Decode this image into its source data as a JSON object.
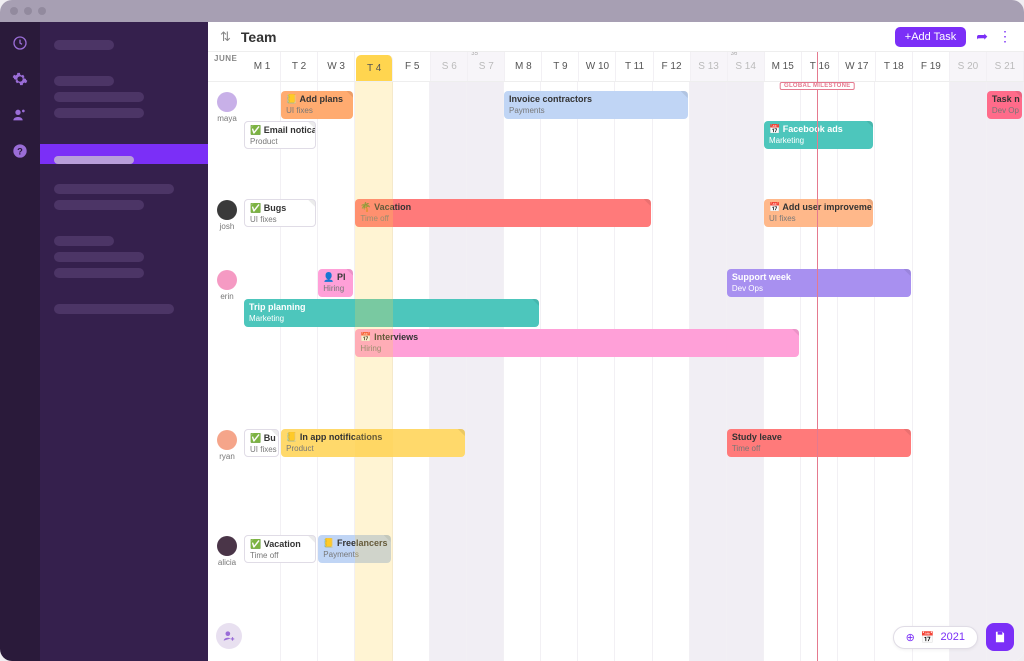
{
  "header": {
    "title": "Team",
    "add_task_label": "+Add Task"
  },
  "month_label": "JUNE",
  "days": [
    {
      "l": "M 1",
      "w": false,
      "today": false,
      "wk": ""
    },
    {
      "l": "T 2",
      "w": false,
      "today": false,
      "wk": ""
    },
    {
      "l": "W 3",
      "w": false,
      "today": false,
      "wk": ""
    },
    {
      "l": "T 4",
      "w": false,
      "today": true,
      "wk": ""
    },
    {
      "l": "F 5",
      "w": false,
      "today": false,
      "wk": ""
    },
    {
      "l": "S 6",
      "w": true,
      "today": false,
      "wk": ""
    },
    {
      "l": "S 7",
      "w": true,
      "today": false,
      "wk": "35"
    },
    {
      "l": "M 8",
      "w": false,
      "today": false,
      "wk": ""
    },
    {
      "l": "T 9",
      "w": false,
      "today": false,
      "wk": ""
    },
    {
      "l": "W 10",
      "w": false,
      "today": false,
      "wk": ""
    },
    {
      "l": "T 11",
      "w": false,
      "today": false,
      "wk": ""
    },
    {
      "l": "F 12",
      "w": false,
      "today": false,
      "wk": ""
    },
    {
      "l": "S 13",
      "w": true,
      "today": false,
      "wk": ""
    },
    {
      "l": "S 14",
      "w": true,
      "today": false,
      "wk": "36"
    },
    {
      "l": "M 15",
      "w": false,
      "today": false,
      "wk": ""
    },
    {
      "l": "T 16",
      "w": false,
      "today": false,
      "wk": ""
    },
    {
      "l": "W 17",
      "w": false,
      "today": false,
      "wk": ""
    },
    {
      "l": "T 18",
      "w": false,
      "today": false,
      "wk": ""
    },
    {
      "l": "F 19",
      "w": false,
      "today": false,
      "wk": ""
    },
    {
      "l": "S 20",
      "w": true,
      "today": false,
      "wk": ""
    },
    {
      "l": "S 21",
      "w": true,
      "today": false,
      "wk": ""
    }
  ],
  "milestone": {
    "label": "GLOBAL MILESTONE",
    "pos_pct": 73.5
  },
  "people": [
    {
      "name": "maya",
      "avatar_color": "#c8b0e8",
      "lanes": [
        [
          {
            "label": "📒 Add plans",
            "tag": "UI fixes",
            "cls": "orange",
            "start": 1,
            "span": 2
          },
          {
            "label": "Invoice contractors",
            "tag": "Payments",
            "cls": "blue",
            "start": 7,
            "span": 5
          },
          {
            "label": "Task n",
            "tag": "Dev Op",
            "cls": "pink",
            "start": 20,
            "span": 1
          }
        ],
        [
          {
            "label": "✅ Email notica",
            "tag": "Product",
            "cls": "white",
            "start": 0,
            "span": 2
          },
          {
            "label": "📅 Facebook ads",
            "tag": "Marketing",
            "cls": "teal",
            "start": 14,
            "span": 3
          }
        ]
      ]
    },
    {
      "name": "josh",
      "avatar_color": "#3a3a3a",
      "lanes": [
        [
          {
            "label": "✅ Bugs",
            "tag": "UI fixes",
            "cls": "white",
            "start": 0,
            "span": 2
          },
          {
            "label": "🌴 Vacation",
            "tag": "Time off",
            "cls": "red",
            "start": 3,
            "span": 8
          },
          {
            "label": "📅 Add user improveme",
            "tag": "UI fixes",
            "cls": "orangel",
            "start": 14,
            "span": 3
          }
        ]
      ]
    },
    {
      "name": "erin",
      "avatar_color": "#f59ac3",
      "lanes": [
        [
          {
            "label": "👤 Pl",
            "tag": "Hiring",
            "cls": "pinkl",
            "start": 2,
            "span": 1
          },
          {
            "label": "Support week",
            "tag": "Dev Ops",
            "cls": "purple",
            "start": 13,
            "span": 5
          }
        ],
        [
          {
            "label": "Trip planning",
            "tag": "Marketing",
            "cls": "teal",
            "start": 0,
            "span": 8
          }
        ],
        [
          {
            "label": "📅 Interviews",
            "tag": "Hiring",
            "cls": "pinkl",
            "start": 3,
            "span": 12
          }
        ]
      ]
    },
    {
      "name": "ryan",
      "avatar_color": "#f5a58a",
      "lanes": [
        [
          {
            "label": "✅ Bu",
            "tag": "UI fixes",
            "cls": "white",
            "start": 0,
            "span": 1
          },
          {
            "label": "📒 In app notifications",
            "tag": "Product",
            "cls": "yellow",
            "start": 1,
            "span": 5
          },
          {
            "label": "Study leave",
            "tag": "Time off",
            "cls": "red",
            "start": 13,
            "span": 5
          }
        ]
      ]
    },
    {
      "name": "alicia",
      "avatar_color": "#4a3548",
      "lanes": [
        [
          {
            "label": "✅ Vacation",
            "tag": "Time off",
            "cls": "white",
            "start": 0,
            "span": 2
          },
          {
            "label": "📒 Freelancers",
            "tag": "Payments",
            "cls": "blue",
            "start": 2,
            "span": 2
          }
        ]
      ]
    }
  ],
  "footer": {
    "year": "2021"
  }
}
